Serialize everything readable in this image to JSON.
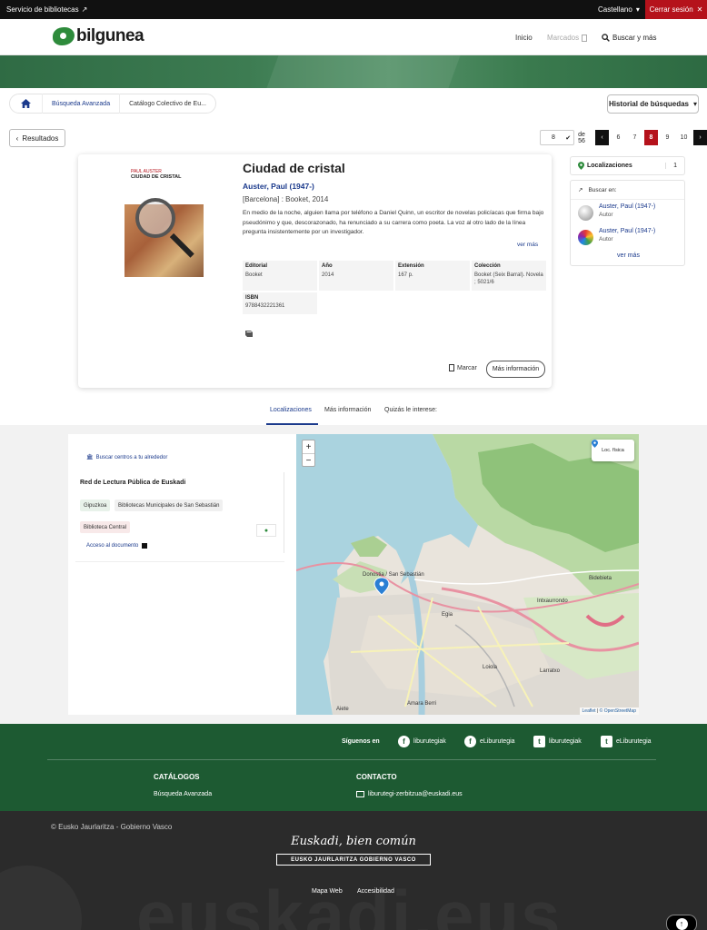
{
  "topbar": {
    "service": "Servicio de bibliotecas",
    "language": "Castellano",
    "logout": "Cerrar sesión"
  },
  "header": {
    "logo": "bilgunea",
    "nav_home": "Inicio",
    "nav_marked": "Marcados",
    "nav_search": "Buscar y más"
  },
  "breadcrumb": {
    "advanced": "Búsqueda Avanzada",
    "current": "Catálogo Colectivo de Eu..."
  },
  "history_label": "Historial de búsquedas",
  "results_label": "Resultados",
  "pagination": {
    "current_input": "8",
    "of_label": "de 56",
    "pages": [
      "6",
      "7",
      "8",
      "9",
      "10"
    ],
    "active": "8"
  },
  "record": {
    "cover_author": "PAUL AUSTER",
    "cover_title": "CIUDAD DE CRISTAL",
    "title": "Ciudad de cristal",
    "author": "Auster, Paul (1947-)",
    "publication": "[Barcelona] : Booket, 2014",
    "description": "En medio de la noche, alguien llama por teléfono a Daniel Quinn, un escritor de novelas policíacas que firma bajo pseudónimo y que, descorazonado, ha renunciado a su carrera como poeta. La voz al otro lado de la línea pregunta insistentemente por un investigador.",
    "see_more": "ver más",
    "facts": [
      {
        "key": "Editorial",
        "value": "Booket"
      },
      {
        "key": "Año",
        "value": "2014"
      },
      {
        "key": "Extensión",
        "value": "167 p."
      },
      {
        "key": "Colección",
        "value": "Booket (Seix Barral). Novela ; 5021/6"
      }
    ],
    "isbn_key": "ISBN",
    "isbn_value": "9788432221361",
    "mark_label": "Marcar",
    "more_info_label": "Más información"
  },
  "side": {
    "locations_label": "Localizaciones",
    "locations_count": "1",
    "search_in_label": "Buscar en:",
    "search_items": [
      {
        "name": "Auster, Paul (1947-)",
        "role": "Autor",
        "icon": "wikipedia-icon"
      },
      {
        "name": "Auster, Paul (1947-)",
        "role": "Autor",
        "icon": "spiral-icon"
      }
    ],
    "see_more": "ver más"
  },
  "tabs": [
    "Localizaciones",
    "Más información",
    "Quizás le interese:"
  ],
  "locations": {
    "near_label": "Buscar centros a tu alrededor",
    "network": "Red de Lectura Pública de Euskadi",
    "province": "Gipuzkoa",
    "library_group": "Bibliotecas Municipales de San Sebastián",
    "library": "Biblioteca Central",
    "access": "Acceso al documento"
  },
  "map": {
    "zoom_in": "+",
    "zoom_out": "−",
    "loc_button": "Loc. física",
    "attribution_leaflet": "Leaflet",
    "attribution_osm": "© OpenStreetMap",
    "labels": {
      "city": "Donostia / San Sebastián",
      "bidebieta": "Bidebieta",
      "intxaurrondo": "Intxaurrondo",
      "egia": "Egia",
      "loiola": "Loiola",
      "larratxo": "Larratxo",
      "amara": "Amara Berri",
      "aiete": "Aiete"
    }
  },
  "footer": {
    "follow_label": "Síguenos en",
    "social": [
      {
        "label": "liburutegiak",
        "icon": "facebook-icon"
      },
      {
        "label": "eLiburutegia",
        "icon": "facebook-icon"
      },
      {
        "label": "liburutegiak",
        "icon": "twitter-icon"
      },
      {
        "label": "eLiburutegia",
        "icon": "twitter-icon"
      }
    ],
    "catalogs_head": "CATÁLOGOS",
    "catalogs_link": "Búsqueda Avanzada",
    "contact_head": "CONTACTO",
    "contact_email": "liburutegi-zerbitzua@euskadi.eus",
    "copyright": "© Eusko Jaurlaritza - Gobierno Vasco",
    "slogan": "Euskadi, bien común",
    "gov_logo": "EUSKO JAURLARITZA  GOBIERNO VASCO",
    "watermark": "euskadi.eus",
    "links": [
      "Mapa Web",
      "Accesibilidad"
    ]
  },
  "colors": {
    "brand_green": "#2e8b3c",
    "footer_green": "#1d5a32",
    "accent_red": "#b5121b",
    "link_blue": "#1b3a8c"
  }
}
